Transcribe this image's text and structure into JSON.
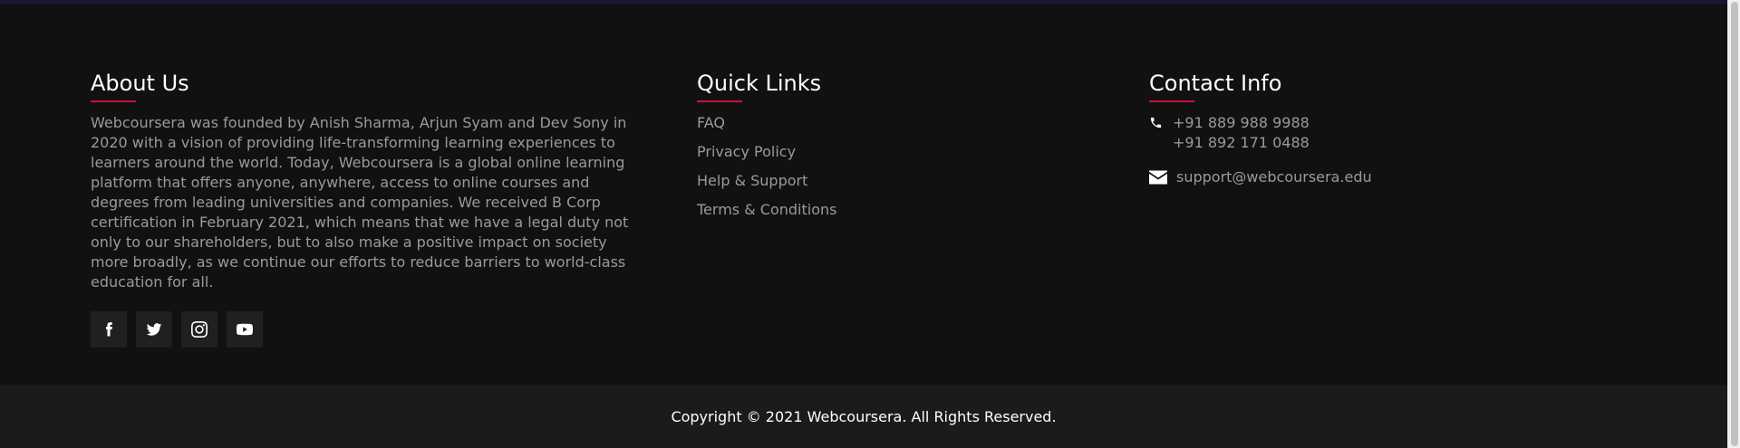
{
  "about": {
    "title": "About Us",
    "text": "Webcoursera was founded by Anish Sharma, Arjun Syam and Dev Sony in 2020 with a vision of providing life-transforming learning experiences to learners around the world. Today, Webcoursera is a global online learning platform that offers anyone, anywhere, access to online courses and degrees from leading universities and companies. We received B Corp certification in February 2021, which means that we have a legal duty not only to our shareholders, but to also make a positive impact on society more broadly, as we continue our efforts to reduce barriers to world-class education for all.",
    "socials": [
      {
        "icon": "facebook-icon"
      },
      {
        "icon": "twitter-icon"
      },
      {
        "icon": "instagram-icon"
      },
      {
        "icon": "youtube-icon"
      }
    ]
  },
  "quick_links": {
    "title": "Quick Links",
    "items": [
      "FAQ",
      "Privacy Policy",
      "Help & Support",
      "Terms & Conditions"
    ]
  },
  "contact": {
    "title": "Contact Info",
    "phone_1": "+91 889 988 9988",
    "phone_2": "+91 892 171 0488",
    "email": "support@webcoursera.edu"
  },
  "footer": {
    "copyright": "Copyright © 2021 Webcoursera. All Rights Reserved."
  },
  "colors": {
    "accent": "#d0103a",
    "background": "#111112",
    "copyright_bg": "#1b1b1c"
  }
}
